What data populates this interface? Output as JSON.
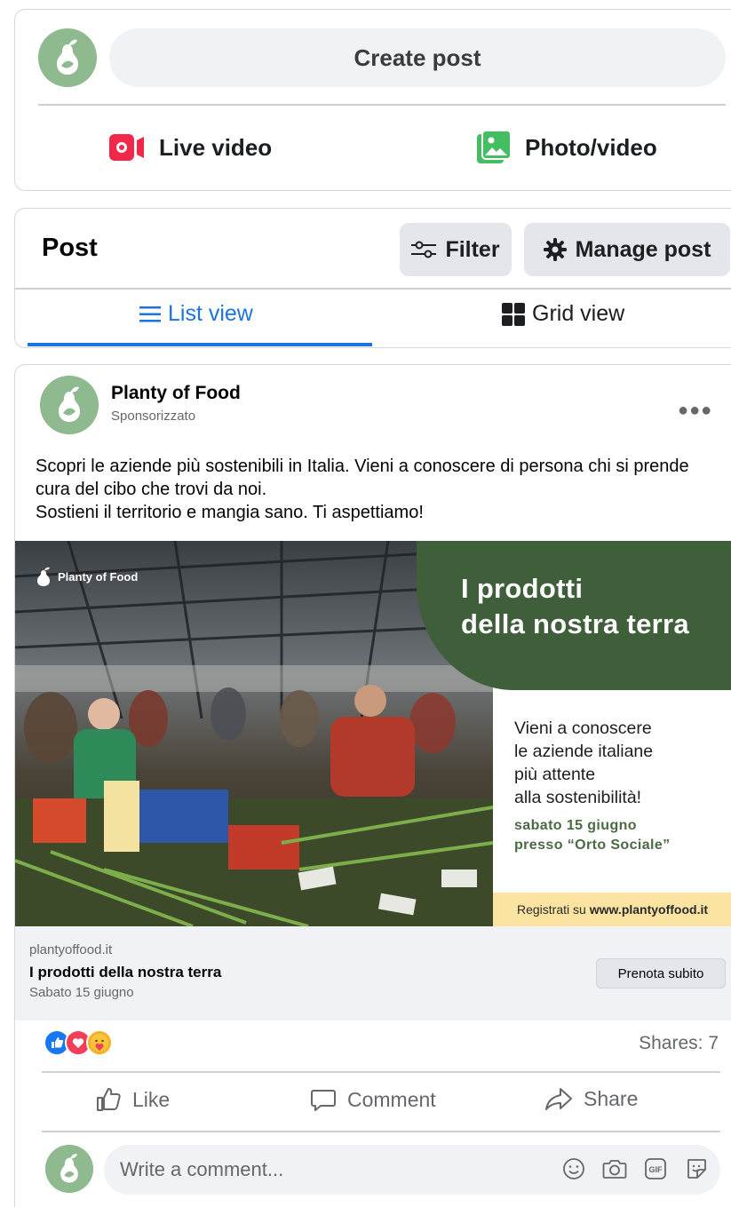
{
  "composer": {
    "create_post_label": "Create post",
    "live_video_label": "Live video",
    "photo_video_label": "Photo/video"
  },
  "post_manager": {
    "heading": "Post",
    "filter_label": "Filter",
    "manage_label": "Manage post",
    "tabs": [
      {
        "label": "List view",
        "active": true
      },
      {
        "label": "Grid view",
        "active": false
      }
    ]
  },
  "feed_post": {
    "page_name": "Planty of Food",
    "sponsored_label": "Sponsorizzato",
    "text_line_1": "Scopri le aziende più sostenibili in Italia. Vieni a conoscere di persona chi si prende cura del cibo che trovi da noi.",
    "text_line_2": "Sostieni il territorio e mangia sano. Ti aspettiamo!",
    "ad": {
      "logo_text": "Planty of Food",
      "title_line_1": "I prodotti",
      "title_line_2": "della nostra terra",
      "body_lines": [
        "Vieni a conoscere",
        "le aziende italiane",
        "più attente",
        "alla sostenibilità!"
      ],
      "date_line_1": "sabato 15 giugno",
      "date_line_2": "presso “Orto Sociale”",
      "register_prefix": "Registrati su",
      "register_url": "www.plantyoffood.it"
    },
    "link": {
      "domain": "plantyoffood.it",
      "title": "I prodotti della nostra terra",
      "subtitle": "Sabato 15 giugno",
      "cta_label": "Prenota subito"
    },
    "shares_text": "Shares: 7",
    "actions": {
      "like": "Like",
      "comment": "Comment",
      "share": "Share"
    },
    "comment_placeholder": "Write a comment..."
  },
  "colors": {
    "accent_blue": "#1b74e4",
    "brand_green": "#3f5e3a",
    "avatar_green": "#8fb98e",
    "live_red": "#f02849",
    "photo_green": "#45bd62"
  }
}
